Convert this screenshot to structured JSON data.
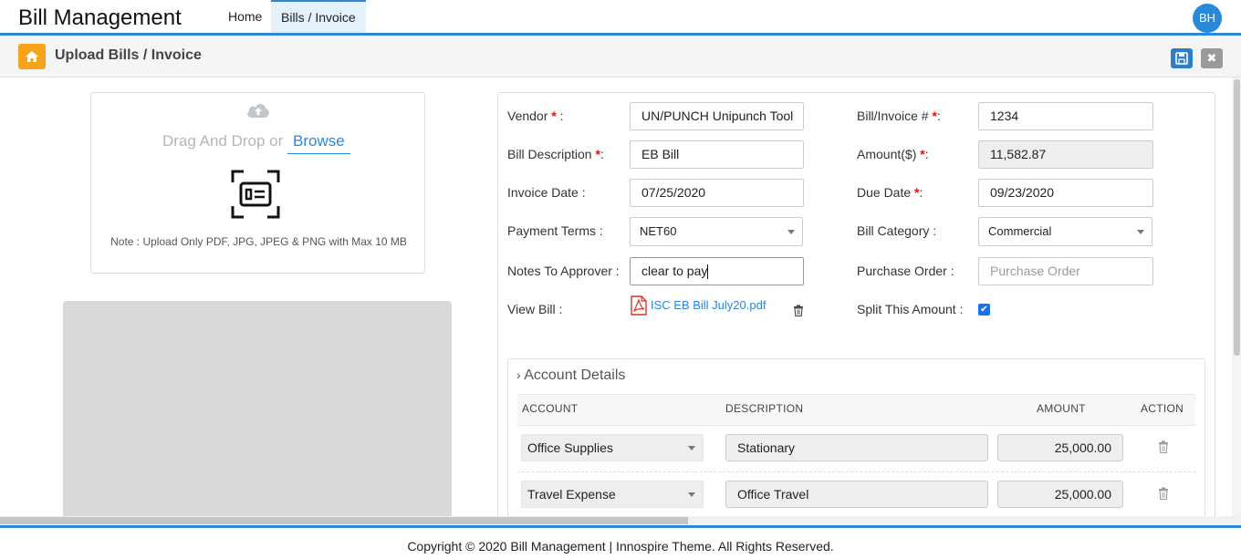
{
  "app": {
    "title": "Bill Management",
    "user_initials": "BH"
  },
  "nav": {
    "home": "Home",
    "bills": "Bills / Invoice"
  },
  "page": {
    "title": "Upload Bills / Invoice"
  },
  "upload": {
    "drag_text": "Drag And Drop or",
    "browse": "Browse",
    "note": "Note : Upload Only PDF, JPG, JPEG & PNG with Max 10 MB"
  },
  "form": {
    "vendor_label": "Vendor",
    "vendor_value": "UN/PUNCH Unipunch Tool",
    "bill_desc_label": "Bill Description",
    "bill_desc_value": "EB Bill",
    "invoice_date_label": "Invoice Date :",
    "invoice_date_value": "07/25/2020",
    "payment_terms_label": "Payment Terms :",
    "payment_terms_value": "NET60",
    "notes_label": "Notes To Approver :",
    "notes_value": "clear to pay",
    "view_bill_label": "View Bill :",
    "view_bill_file": "ISC EB Bill July20.pdf",
    "bill_no_label": "Bill/Invoice #",
    "bill_no_value": "1234",
    "amount_label": "Amount($)",
    "amount_value": "11,582.87",
    "due_date_label": "Due Date",
    "due_date_value": "09/23/2020",
    "bill_category_label": "Bill Category :",
    "bill_category_value": "Commercial",
    "purchase_order_label": "Purchase Order :",
    "purchase_order_placeholder": "Purchase Order",
    "split_label": "Split This Amount :",
    "split_checked": true
  },
  "account_details": {
    "title": "Account Details",
    "columns": {
      "account": "ACCOUNT",
      "description": "DESCRIPTION",
      "amount": "AMOUNT",
      "action": "ACTION"
    },
    "rows": [
      {
        "account": "Office Supplies",
        "description": "Stationary",
        "amount": "25,000.00"
      },
      {
        "account": "Travel Expense",
        "description": "Office Travel",
        "amount": "25,000.00"
      }
    ]
  },
  "footer": {
    "text": "Copyright © 2020 Bill Management | Innospire Theme. All Rights Reserved."
  },
  "colors": {
    "accent": "#2a88d8",
    "home_button": "#f7a21b",
    "required": "#dd1111"
  }
}
